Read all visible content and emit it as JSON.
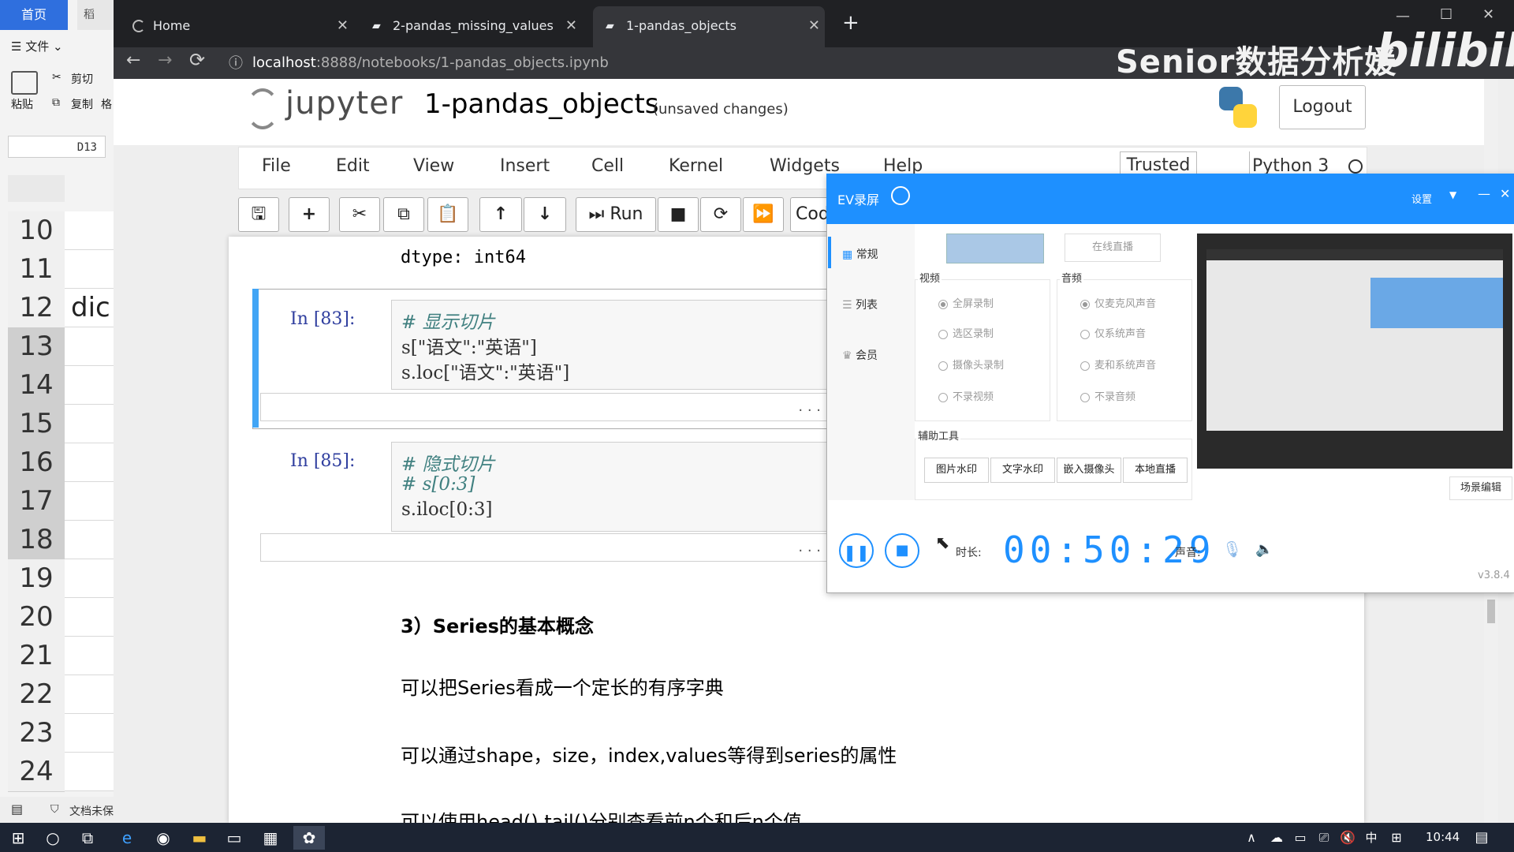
{
  "sheet": {
    "tab_home": "首页",
    "tab2": "稻",
    "menu_file": "☰ 文件 ⌄",
    "paste": "粘贴",
    "cut": "剪切",
    "copy": "复制",
    "format": "格",
    "cell_ref": "D13",
    "rows": [
      {
        "num": "10",
        "value": "",
        "selected": false
      },
      {
        "num": "11",
        "value": "",
        "selected": false
      },
      {
        "num": "12",
        "value": "dic",
        "selected": false
      },
      {
        "num": "13",
        "value": "",
        "selected": true
      },
      {
        "num": "14",
        "value": "",
        "selected": true
      },
      {
        "num": "15",
        "value": "",
        "selected": true
      },
      {
        "num": "16",
        "value": "",
        "selected": true
      },
      {
        "num": "17",
        "value": "",
        "selected": true
      },
      {
        "num": "18",
        "value": "",
        "selected": true
      },
      {
        "num": "19",
        "value": "",
        "selected": false
      },
      {
        "num": "20",
        "value": "",
        "selected": false
      },
      {
        "num": "21",
        "value": "",
        "selected": false
      },
      {
        "num": "22",
        "value": "",
        "selected": false
      },
      {
        "num": "23",
        "value": "",
        "selected": false
      },
      {
        "num": "24",
        "value": "",
        "selected": false
      }
    ],
    "status": "文档未保"
  },
  "browser": {
    "tabs": [
      {
        "label": "Home"
      },
      {
        "label": "2-pandas_missing_values"
      },
      {
        "label": "1-pandas_objects"
      }
    ],
    "new_tab": "+",
    "address_host": "localhost",
    "address_path": ":8888/notebooks/1-pandas_objects.ipynb",
    "watermark": "Senior数据分析媛",
    "bili_logo": "bilibili"
  },
  "jupyter": {
    "logo_text": "jupyter",
    "title": "1-pandas_objects",
    "unsaved": "(unsaved changes)",
    "logout": "Logout",
    "menu": [
      "File",
      "Edit",
      "View",
      "Insert",
      "Cell",
      "Kernel",
      "Widgets",
      "Help"
    ],
    "trusted": "Trusted",
    "kernel": "Python 3",
    "run_label": "Run",
    "cell_type": "Cod",
    "prev_output": "dtype: int64",
    "cells": [
      {
        "prompt": "In  [83]:",
        "lines": [
          "# 显示切片",
          "s[\"语文\":\"英语\"]",
          "s.loc[\"语文\":\"英语\"]"
        ]
      },
      {
        "prompt": "In  [85]:",
        "lines": [
          "# 隐式切片",
          "# s[0:3]",
          "s.iloc[0:3]"
        ]
      }
    ],
    "ellipsis": ". . .",
    "md_heading": "3）Series的基本概念",
    "md_lines": [
      "可以把Series看成一个定长的有序字典",
      "可以通过shape，size，index,values等得到series的属性",
      "可以使用head(),tail()分别查看前n个和后n个值"
    ]
  },
  "ev": {
    "title": "EV录屏",
    "settings": "设置",
    "sidebar": [
      "常规",
      "列表",
      "会员"
    ],
    "live_btn": "在线直播",
    "video_label": "视频",
    "audio_label": "音频",
    "video_opts": [
      "全屏录制",
      "选区录制",
      "摄像头录制",
      "不录视频"
    ],
    "audio_opts": [
      "仅麦克风声音",
      "仅系统声音",
      "麦和系统声音",
      "不录音频"
    ],
    "tools_label": "辅助工具",
    "tools": [
      "图片水印",
      "文字水印",
      "嵌入摄像头",
      "本地直播"
    ],
    "scene_edit": "场景编辑",
    "duration_label": "时长:",
    "timer": "00:50:29",
    "sound_label": "声音:",
    "version": "v3.8.4"
  },
  "taskbar": {
    "time": "10:44",
    "ime": "中"
  }
}
